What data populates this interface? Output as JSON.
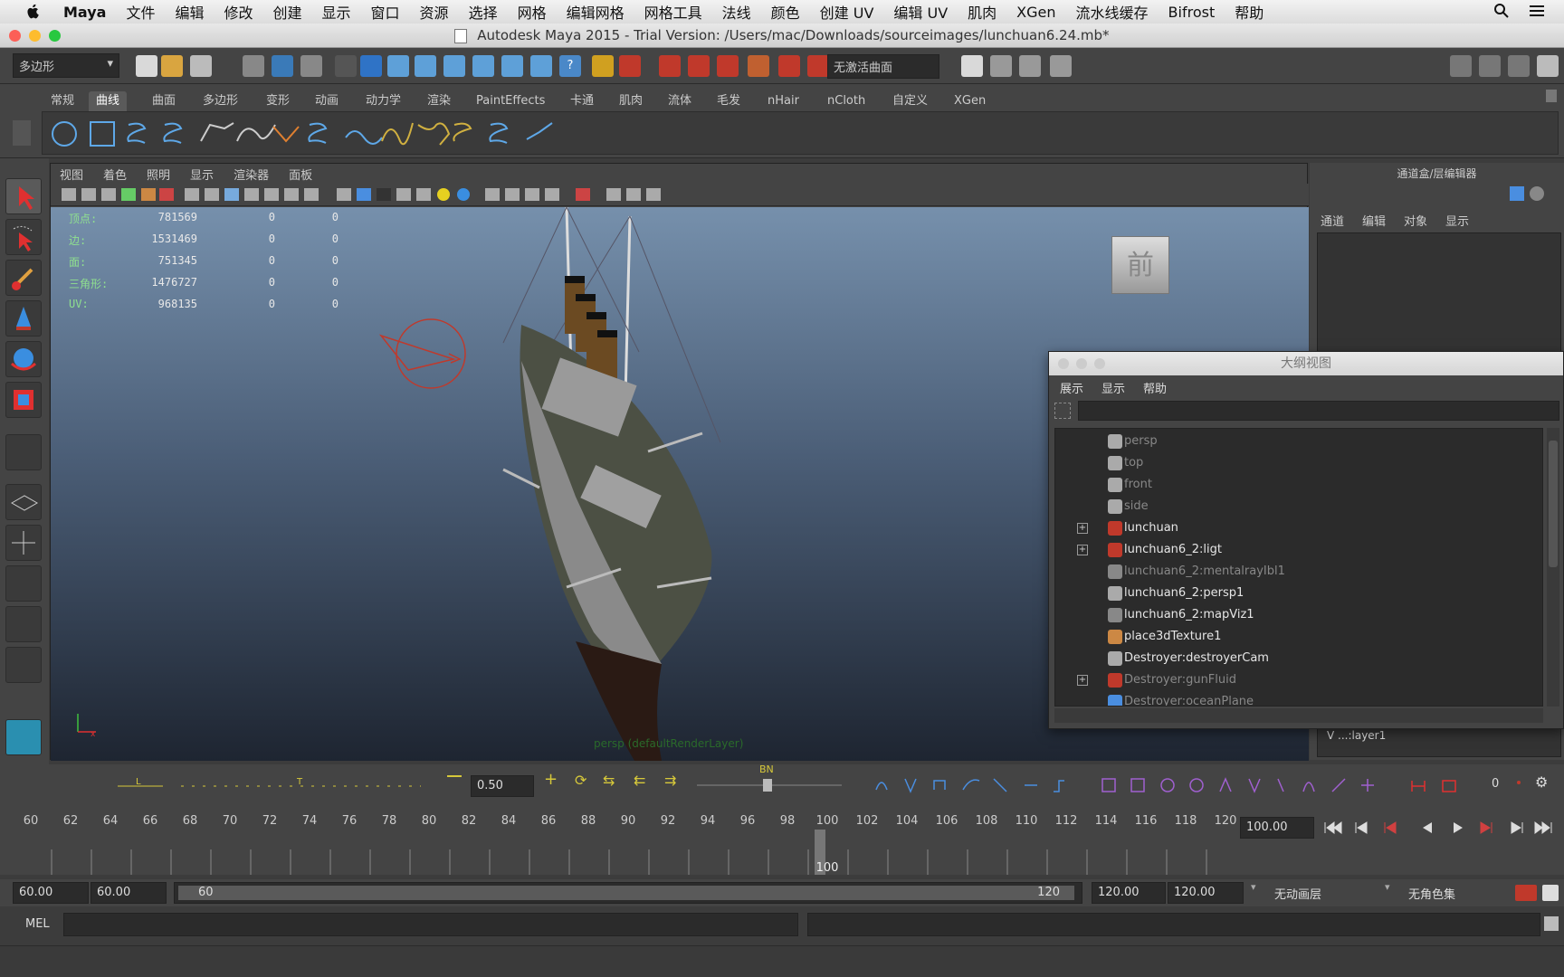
{
  "macmenu": {
    "items": [
      "Maya",
      "文件",
      "编辑",
      "修改",
      "创建",
      "显示",
      "窗口",
      "资源",
      "选择",
      "网格",
      "编辑网格",
      "网格工具",
      "法线",
      "颜色",
      "创建 UV",
      "编辑 UV",
      "肌肉",
      "XGen",
      "流水线缓存",
      "Bifrost",
      "帮助"
    ]
  },
  "window": {
    "title": "Autodesk Maya 2015 - Trial Version: /Users/mac/Downloads/sourceimages/lunchuan6.24.mb*"
  },
  "toolbar": {
    "mode_select": "多边形",
    "live_surface": "无激活曲面"
  },
  "shelf": {
    "tabs": [
      "常规",
      "曲线",
      "曲面",
      "多边形",
      "变形",
      "动画",
      "动力学",
      "渲染",
      "PaintEffects",
      "卡通",
      "肌肉",
      "流体",
      "毛发",
      "nHair",
      "nCloth",
      "自定义",
      "XGen"
    ],
    "active_tab": "曲线"
  },
  "viewport": {
    "menus": [
      "视图",
      "着色",
      "照明",
      "显示",
      "渲染器",
      "面板"
    ],
    "hud": [
      {
        "label": "顶点:",
        "v1": "781569",
        "v2": "0",
        "v3": "0"
      },
      {
        "label": "边:",
        "v1": "1531469",
        "v2": "0",
        "v3": "0"
      },
      {
        "label": "面:",
        "v1": "751345",
        "v2": "0",
        "v3": "0"
      },
      {
        "label": "三角形:",
        "v1": "1476727",
        "v2": "0",
        "v3": "0"
      },
      {
        "label": "UV:",
        "v1": "968135",
        "v2": "0",
        "v3": "0"
      }
    ],
    "camera_label": "persp (defaultRenderLayer)",
    "viewcube_label": "前"
  },
  "channelbox": {
    "title": "通道盒/层编辑器",
    "menus": [
      "通道",
      "编辑",
      "对象",
      "显示"
    ],
    "layer_label": "V  ...:layer1"
  },
  "outliner": {
    "title": "大纲视图",
    "menus": [
      "展示",
      "显示",
      "帮助"
    ],
    "items": [
      {
        "name": "persp",
        "dim": true,
        "expand": false,
        "icon": "camera-icon"
      },
      {
        "name": "top",
        "dim": true,
        "expand": false,
        "icon": "camera-icon"
      },
      {
        "name": "front",
        "dim": true,
        "expand": false,
        "icon": "camera-icon"
      },
      {
        "name": "side",
        "dim": true,
        "expand": false,
        "icon": "camera-icon"
      },
      {
        "name": "lunchuan",
        "dim": false,
        "expand": true,
        "icon": "transform-icon"
      },
      {
        "name": "lunchuan6_2:ligt",
        "dim": false,
        "expand": true,
        "icon": "transform-icon"
      },
      {
        "name": "lunchuan6_2:mentalrayIbl1",
        "dim": true,
        "expand": false,
        "icon": "node-icon"
      },
      {
        "name": "lunchuan6_2:persp1",
        "dim": false,
        "expand": false,
        "icon": "camera-icon"
      },
      {
        "name": "lunchuan6_2:mapViz1",
        "dim": false,
        "expand": false,
        "icon": "node-icon"
      },
      {
        "name": "place3dTexture1",
        "dim": false,
        "expand": false,
        "icon": "texture-icon"
      },
      {
        "name": "Destroyer:destroyerCam",
        "dim": false,
        "expand": false,
        "icon": "camera-icon"
      },
      {
        "name": "Destroyer:gunFluid",
        "dim": true,
        "expand": true,
        "icon": "transform-icon"
      },
      {
        "name": "Destroyer:oceanPlane",
        "dim": true,
        "expand": false,
        "icon": "plane-icon"
      }
    ]
  },
  "anim": {
    "bias_value": "0.50",
    "bn_label": "BN",
    "key_count": "0"
  },
  "timeline": {
    "ticks": [
      "60",
      "62",
      "64",
      "66",
      "68",
      "70",
      "72",
      "74",
      "76",
      "78",
      "80",
      "82",
      "84",
      "86",
      "88",
      "90",
      "92",
      "94",
      "96",
      "98",
      "100",
      "102",
      "104",
      "106",
      "108",
      "110",
      "112",
      "114",
      "116",
      "118",
      "120"
    ],
    "current_frame": "100",
    "current_time_field": "100.00"
  },
  "range": {
    "start_outer": "60.00",
    "start_inner": "60.00",
    "slider_start": "60",
    "slider_end": "120",
    "end_inner": "120.00",
    "end_outer": "120.00",
    "anim_layer": "无动画层",
    "character_set": "无角色集"
  },
  "mel": {
    "label": "MEL"
  },
  "colors": {
    "accent_red": "#c0392b",
    "hud_green": "#8fe08f",
    "scene_top": "#7690ac"
  }
}
